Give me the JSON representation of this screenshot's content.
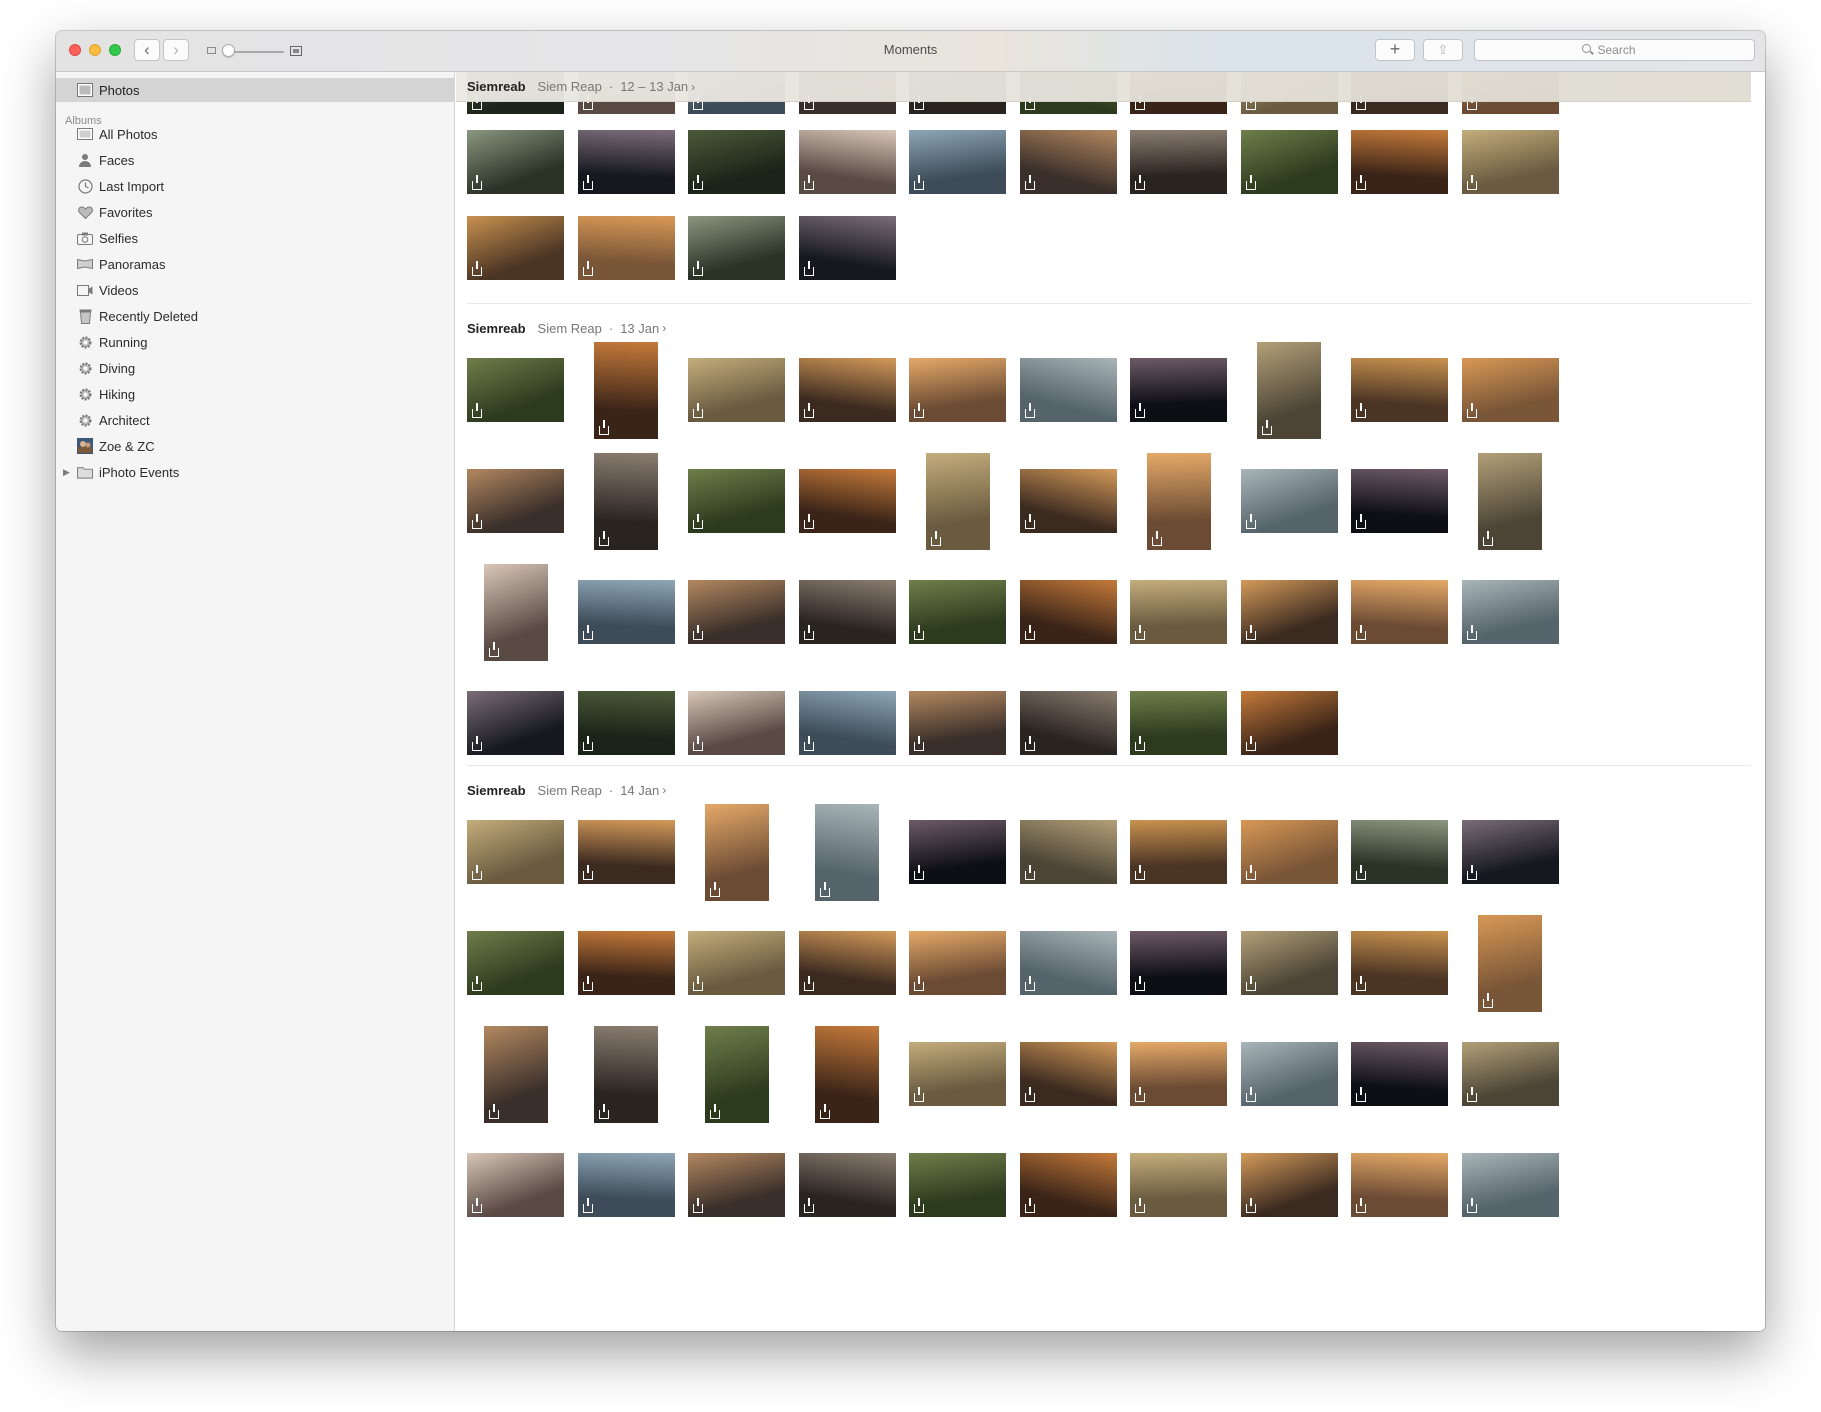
{
  "window": {
    "title": "Moments",
    "search_placeholder": "Search",
    "add_label": "+",
    "back_label": "‹",
    "forward_label": "›",
    "share_label": "⇪"
  },
  "sidebar": {
    "top_item": "Photos",
    "albums_header": "Albums",
    "items": [
      {
        "label": "All Photos",
        "icon": "all-photos-icon"
      },
      {
        "label": "Faces",
        "icon": "person-icon"
      },
      {
        "label": "Last Import",
        "icon": "clock-icon"
      },
      {
        "label": "Favorites",
        "icon": "heart-icon"
      },
      {
        "label": "Selfies",
        "icon": "camera-icon"
      },
      {
        "label": "Panoramas",
        "icon": "panorama-icon"
      },
      {
        "label": "Videos",
        "icon": "video-icon"
      },
      {
        "label": "Recently Deleted",
        "icon": "trash-icon"
      },
      {
        "label": "Running",
        "icon": "gear-icon"
      },
      {
        "label": "Diving",
        "icon": "gear-icon"
      },
      {
        "label": "Hiking",
        "icon": "gear-icon"
      },
      {
        "label": "Architect",
        "icon": "gear-icon"
      },
      {
        "label": "Zoe & ZC",
        "icon": "album-cover-icon"
      },
      {
        "label": "iPhoto Events",
        "icon": "folder-icon"
      }
    ]
  },
  "moments": [
    {
      "title": "Siemreab",
      "location": "Siem Reap",
      "date": "12 – 13 Jan",
      "rows": [
        10,
        10,
        4
      ]
    },
    {
      "title": "Siemreab",
      "location": "Siem Reap",
      "date": "13 Jan",
      "rows": [
        10,
        10,
        10,
        8
      ]
    },
    {
      "title": "Siemreab",
      "location": "Siem Reap",
      "date": "14 Jan",
      "rows": [
        10,
        10,
        10,
        10
      ]
    }
  ],
  "separator": "·",
  "chevron": "›",
  "colors": {
    "accent_close": "#fc605b",
    "accent_minimize": "#fdbc40",
    "accent_zoom": "#34c84a",
    "sidebar_bg": "#f5f5f5",
    "sidebar_selected": "#d4d4d4"
  }
}
